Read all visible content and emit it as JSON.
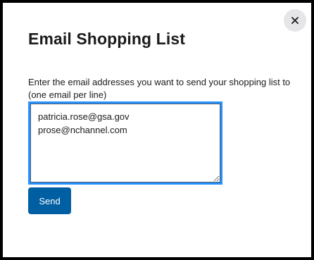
{
  "dialog": {
    "title": "Email Shopping List",
    "close_icon": "close-icon",
    "instructions": "Enter the email addresses you want to send your shopping list to (one email per line)",
    "emails_value": "patricia.rose@gsa.gov\nprose@nchannel.com",
    "send_label": "Send"
  },
  "colors": {
    "focus_outline": "#2491ff",
    "primary_button": "#005ea2",
    "close_button_bg": "#e6e6e9",
    "frame_border": "#000000"
  }
}
